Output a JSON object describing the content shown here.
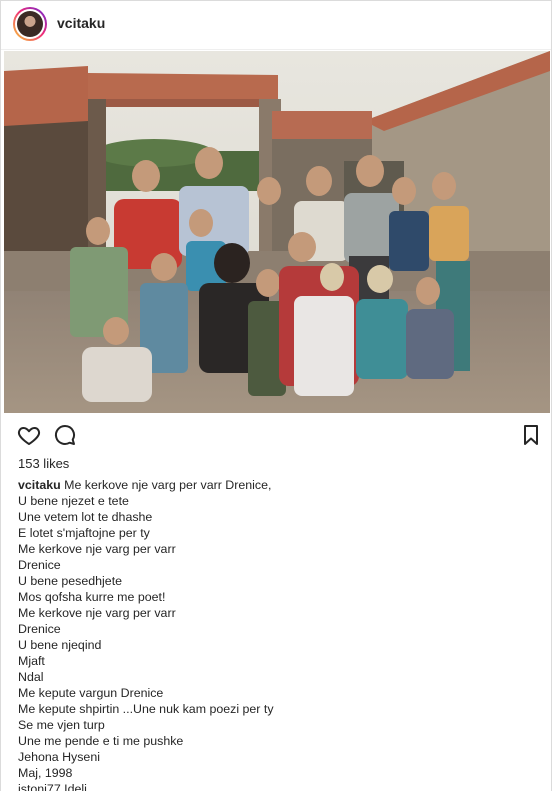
{
  "header": {
    "username": "vcitaku"
  },
  "post": {
    "image_alt": "old group photo of children",
    "likes": "153 likes",
    "caption_username": "vcitaku",
    "caption_lines": [
      "Me kerkove nje varg per varr Drenice,",
      "U bene njezet e tete",
      "Une vetem lot te dhashe",
      "E lotet s'mjaftojne per ty",
      "Me kerkove nje varg per varr",
      "Drenice",
      "U bene pesedhjete",
      "Mos qofsha kurre me poet!",
      "Me kerkove nje varg per varr",
      "Drenice",
      "U bene njeqind",
      "Mjaft",
      "Ndal",
      "Me kepute vargun Drenice",
      "Me kepute shpirtin ...Une nuk kam poezi per ty",
      "Se me vjen turp",
      "Une me pende e ti me pushke",
      "Jehona Hyseni",
      "Maj, 1998"
    ],
    "next_comment_partial": "istoni77 Ideli"
  },
  "icons": {
    "like": "heart-icon",
    "comment": "comment-icon",
    "save": "bookmark-icon"
  }
}
